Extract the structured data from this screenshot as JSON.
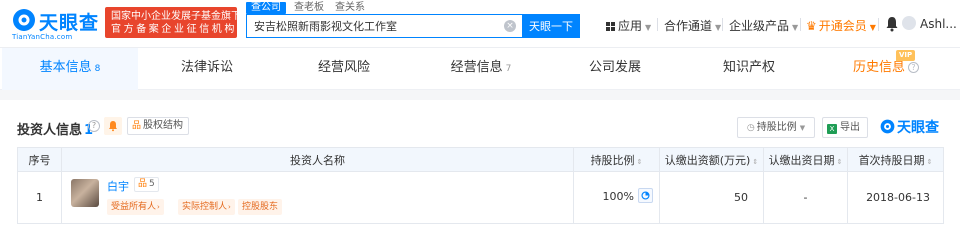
{
  "header": {
    "logo_text": "天眼查",
    "logo_domain": "TianYanCha.com",
    "gov_badge": [
      "国家中小企业发展子基金旗下",
      "官方备案企业征信机构"
    ],
    "search_tabs": [
      "查公司",
      "查老板",
      "查关系"
    ],
    "search_value": "安吉松照新雨影视文化工作室",
    "search_button": "天眼一下",
    "nav": {
      "app": "应用",
      "cooperation": "合作通道",
      "enterprise": "企业级产品",
      "vip": "开通会员",
      "user": "Ashl..."
    },
    "colors": {
      "accent": "#0084ff",
      "vip": "#ff7a00",
      "badge": "#e8452c"
    }
  },
  "tabs": [
    {
      "label": "基本信息",
      "count": "8",
      "active": true
    },
    {
      "label": "法律诉讼",
      "count": ""
    },
    {
      "label": "经营风险",
      "count": ""
    },
    {
      "label": "经营信息",
      "count": "7"
    },
    {
      "label": "公司发展",
      "count": ""
    },
    {
      "label": "知识产权",
      "count": ""
    },
    {
      "label": "历史信息",
      "count": "",
      "vip": "VIP"
    }
  ],
  "section": {
    "title": "投资人信息",
    "count": "1",
    "equity_button": "股权结构",
    "sort_button": "持股比例",
    "export_button": "导出",
    "brand": "天眼查"
  },
  "table": {
    "columns": [
      "序号",
      "投资人名称",
      "持股比例",
      "认缴出资额(万元)",
      "认缴出资日期",
      "首次持股日期"
    ],
    "rows": [
      {
        "index": "1",
        "name": "白宇",
        "related_count": "5",
        "tags": [
          "受益所有人",
          "实际控制人",
          "控股股东"
        ],
        "ratio": "100%",
        "subscribed_amount": "50",
        "subscribed_date": "-",
        "first_hold_date": "2018-06-13"
      }
    ]
  }
}
